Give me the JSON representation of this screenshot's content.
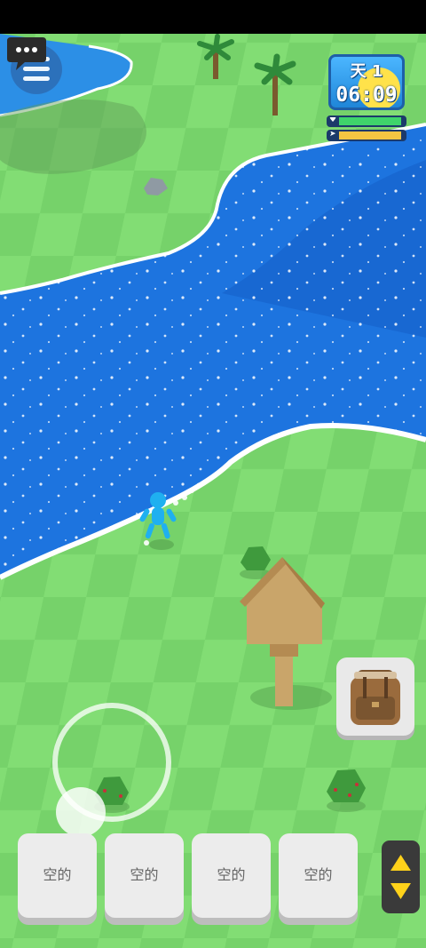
{
  "hud": {
    "day_label": "天 1",
    "clock_time": "06:09",
    "health_level": 0.95,
    "hunger_level": 0.95
  },
  "inventory": {
    "slots": [
      {
        "label": "空的"
      },
      {
        "label": "空的"
      },
      {
        "label": "空的"
      },
      {
        "label": "空的"
      }
    ]
  },
  "colors": {
    "grass_light": "#82dd74",
    "grass_dark": "#74d168",
    "water": "#1d74df",
    "water_deep": "#1560c9",
    "foam": "#ffffff",
    "panel_blue": "#2d6fb8",
    "health_green": "#3fd46b",
    "hunger_yellow": "#f4c542",
    "arrow_yellow": "#ffd21a"
  },
  "icons": {
    "menu": "hamburger-icon",
    "chat": "speech-bubble-icon",
    "health": "heart-icon",
    "hunger": "fish-icon",
    "backpack": "backpack-icon",
    "cycle": "up-down-arrows-icon"
  }
}
